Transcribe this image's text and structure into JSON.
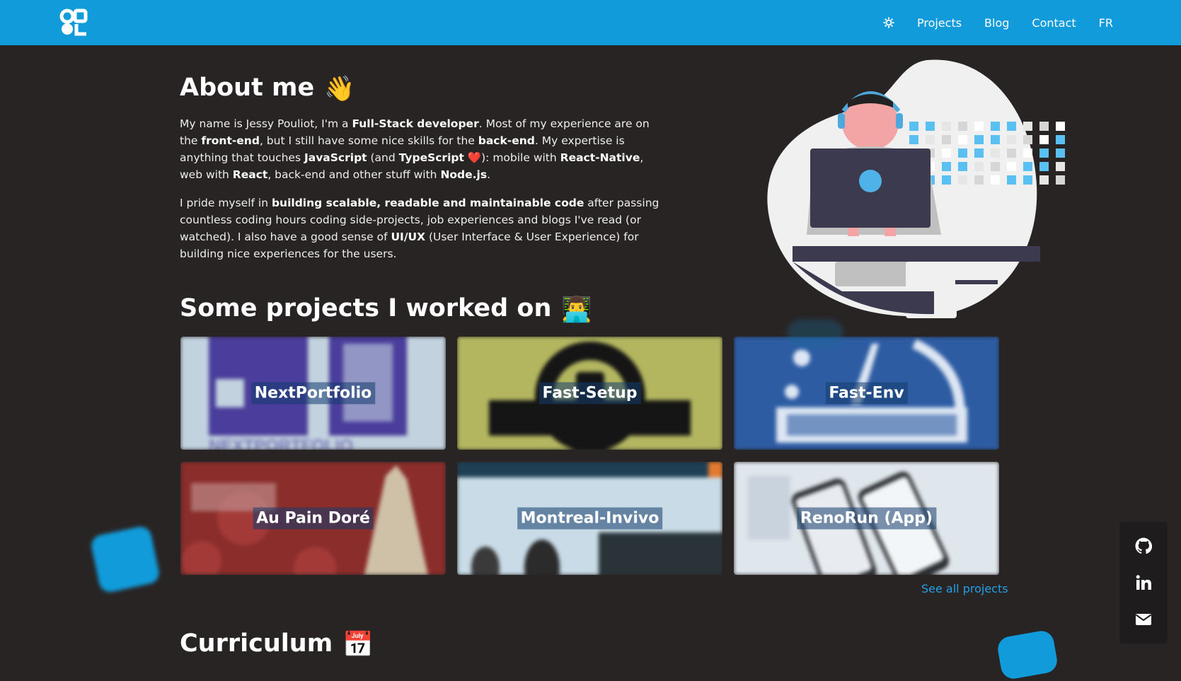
{
  "header": {
    "logo_icon": "jp-logo-icon",
    "theme_icon": "sun-gear-icon",
    "nav": [
      "Projects",
      "Blog",
      "Contact",
      "FR"
    ]
  },
  "about": {
    "title": "About me",
    "title_emoji": "👋",
    "p1": [
      "My name is Jessy Pouliot, I'm a ",
      "Full-Stack developer",
      ". Most of my experience are on the ",
      "front-end",
      ", but I still have some nice skills for the ",
      "back-end",
      ". My expertise is anything that touches ",
      "JavaScript",
      " (and ",
      "TypeScript",
      " ❤️): mobile with ",
      "React-Native",
      ", web with ",
      "React",
      ", back-end and other stuff with ",
      "Node.js",
      "."
    ],
    "p2": [
      "I pride myself in ",
      "building scalable, readable and maintainable code",
      " after passing countless coding hours coding side-projects, job experiences and blogs I've read (or watched). I also have a good sense of ",
      "UI/UX",
      " (User Interface & User Experience) for building nice experiences for the users."
    ]
  },
  "projects": {
    "title": "Some projects I worked on",
    "title_emoji": "👨‍💻",
    "items": [
      {
        "label": "NextPortfolio",
        "color": "#c2d2df"
      },
      {
        "label": "Fast-Setup",
        "color": "#b3b65f"
      },
      {
        "label": "Fast-Env",
        "color": "#2d5ca3"
      },
      {
        "label": "Au Pain Doré",
        "color": "#8a2d2b"
      },
      {
        "label": "Montreal-Invivo",
        "color": "#c8dbe6"
      },
      {
        "label": "RenoRun (App)",
        "color": "#dfe6ec"
      }
    ],
    "see_all": "See all projects"
  },
  "curriculum": {
    "title": "Curriculum",
    "title_emoji": "📅"
  },
  "social": {
    "icons": [
      "github-icon",
      "linkedin-icon",
      "mail-icon"
    ]
  },
  "colors": {
    "brand": "#119bda",
    "background": "#282424",
    "link": "#22a0e6"
  }
}
